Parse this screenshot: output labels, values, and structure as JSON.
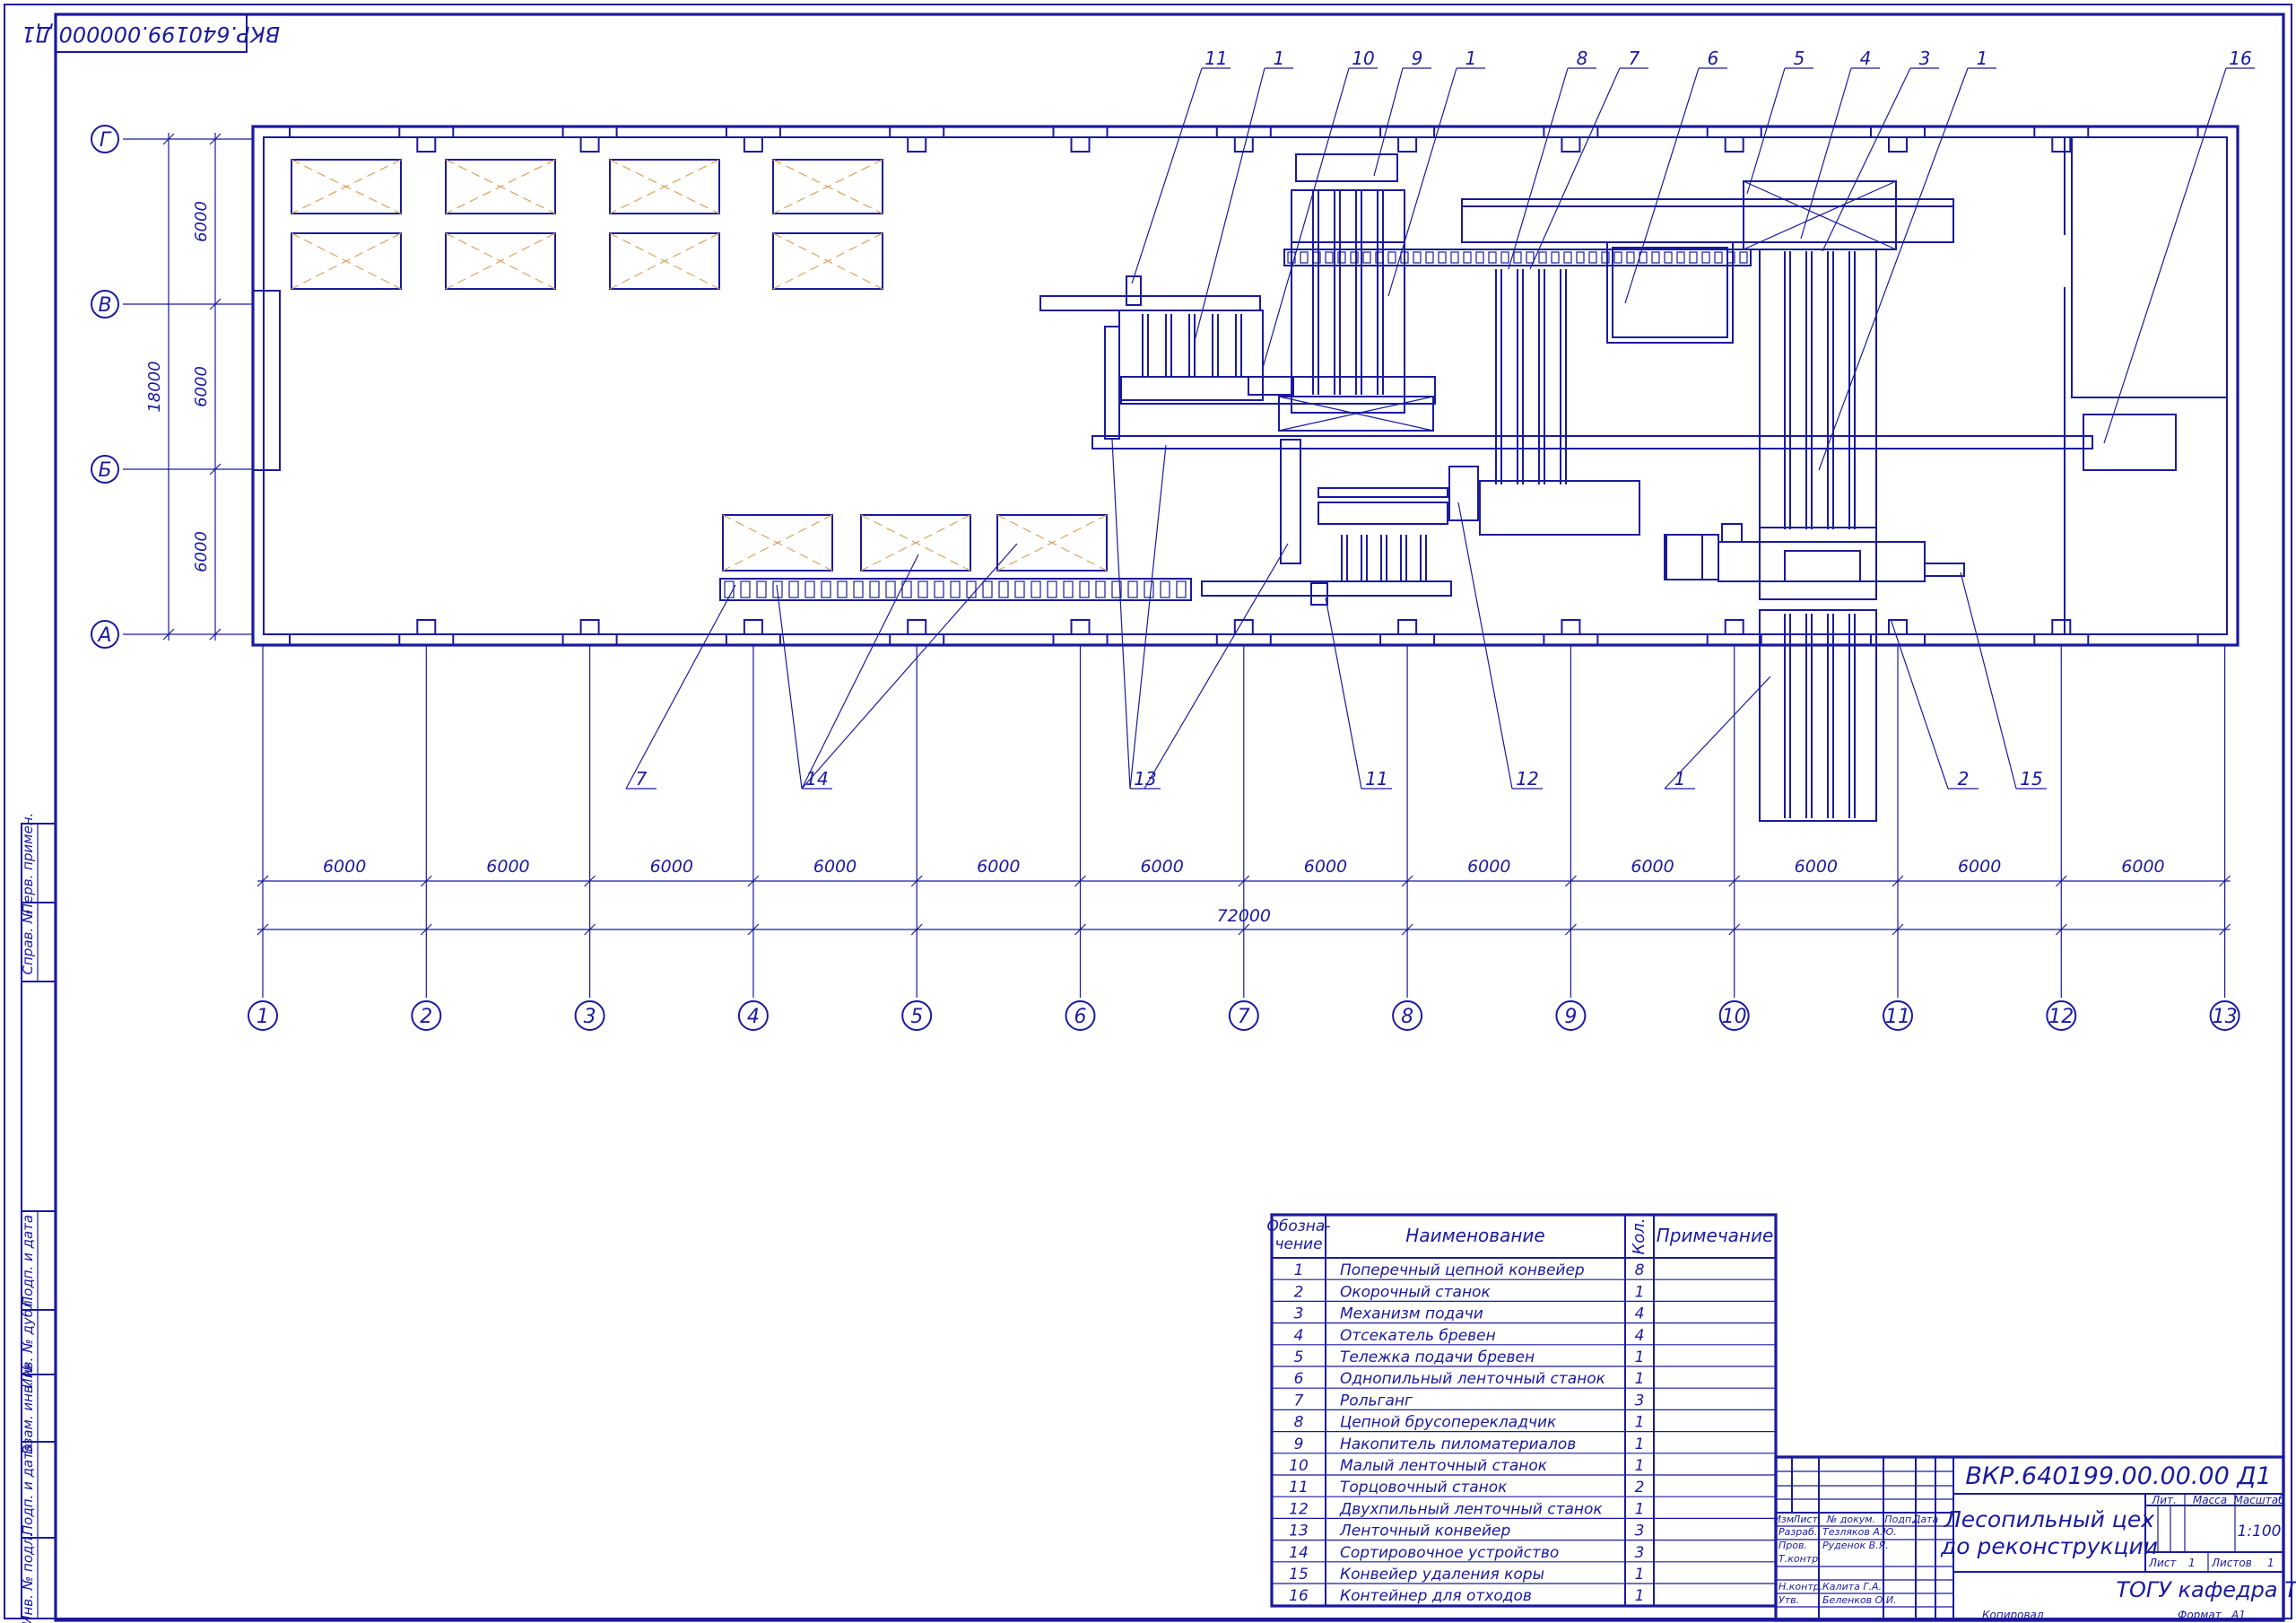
{
  "stamp_rotated": "ВКР.640199.000000 Д1",
  "row_axes": [
    {
      "label": "Г"
    },
    {
      "label": "В"
    },
    {
      "label": "Б"
    },
    {
      "label": "А"
    }
  ],
  "row_dims": [
    "6000",
    "6000",
    "6000"
  ],
  "row_total": "18000",
  "col_axes": [
    "1",
    "2",
    "3",
    "4",
    "5",
    "6",
    "7",
    "8",
    "9",
    "10",
    "11",
    "12",
    "13"
  ],
  "col_dims": [
    "6000",
    "6000",
    "6000",
    "6000",
    "6000",
    "6000",
    "6000",
    "6000",
    "6000",
    "6000",
    "6000",
    "6000"
  ],
  "col_total": "72000",
  "callouts_top": [
    "11",
    "1",
    "10",
    "9",
    "1",
    "8",
    "7",
    "6",
    "5",
    "4",
    "3",
    "1",
    "16"
  ],
  "callouts_bottom": [
    "7",
    "14",
    "13",
    "11",
    "12",
    "1",
    "2",
    "15"
  ],
  "side_labels": [
    "Перв. примен.",
    "Справ. №",
    "Подп. и дата",
    "Инв. № дубл.",
    "Взам. инв. №",
    "Подп. и дата",
    "Инв. № подл."
  ],
  "spec": {
    "headers": {
      "designation": "Обозна-\nчение",
      "name": "Наименование",
      "qty": "Кол.",
      "note": "Примечание"
    },
    "rows": [
      {
        "n": "1",
        "name": "Поперечный цепной конвейер",
        "qty": "8"
      },
      {
        "n": "2",
        "name": "Окорочный станок",
        "qty": "1"
      },
      {
        "n": "3",
        "name": "Механизм подачи",
        "qty": "4"
      },
      {
        "n": "4",
        "name": "Отсекатель бревен",
        "qty": "4"
      },
      {
        "n": "5",
        "name": "Тележка подачи бревен",
        "qty": "1"
      },
      {
        "n": "6",
        "name": "Однопильный ленточный станок",
        "qty": "1"
      },
      {
        "n": "7",
        "name": "Рольганг",
        "qty": "3"
      },
      {
        "n": "8",
        "name": "Цепной брусоперекладчик",
        "qty": "1"
      },
      {
        "n": "9",
        "name": "Накопитель пиломатериалов",
        "qty": "1"
      },
      {
        "n": "10",
        "name": "Малый ленточный станок",
        "qty": "1"
      },
      {
        "n": "11",
        "name": "Торцовочный станок",
        "qty": "2"
      },
      {
        "n": "12",
        "name": "Двухпильный ленточный станок",
        "qty": "1"
      },
      {
        "n": "13",
        "name": "Ленточный конвейер",
        "qty": "3"
      },
      {
        "n": "14",
        "name": "Сортировочное устройство",
        "qty": "3"
      },
      {
        "n": "15",
        "name": "Конвейер удаления коры",
        "qty": "1"
      },
      {
        "n": "16",
        "name": "Контейнер для отходов",
        "qty": "1"
      }
    ]
  },
  "title_block": {
    "doc_code": "ВКР.640199.00.00.00 Д1",
    "title_line1": "Лесопильный цех",
    "title_line2": "до реконструкции",
    "col_headers": [
      "Изм",
      "Лист",
      "№ докум.",
      "Подп.",
      "Дата"
    ],
    "roles": [
      {
        "role": "Разраб.",
        "name": "Тезляков А.Ю."
      },
      {
        "role": "Пров.",
        "name": "Руденок В.Я."
      },
      {
        "role": "Т.контр.",
        "name": ""
      },
      {
        "role": "Н.контр.",
        "name": "Калита Г.А."
      },
      {
        "role": "Утв.",
        "name": "Беленков О.И."
      }
    ],
    "lit": "Лит.",
    "mass": "Масса",
    "scale_label": "Масштаб",
    "scale": "1:100",
    "sheet_label": "Лист",
    "sheet": "1",
    "sheets_label": "Листов",
    "sheets": "1",
    "org": "ТОГУ кафедра ТД",
    "copied": "Копировал",
    "format_label": "Формат",
    "format": "А1"
  }
}
